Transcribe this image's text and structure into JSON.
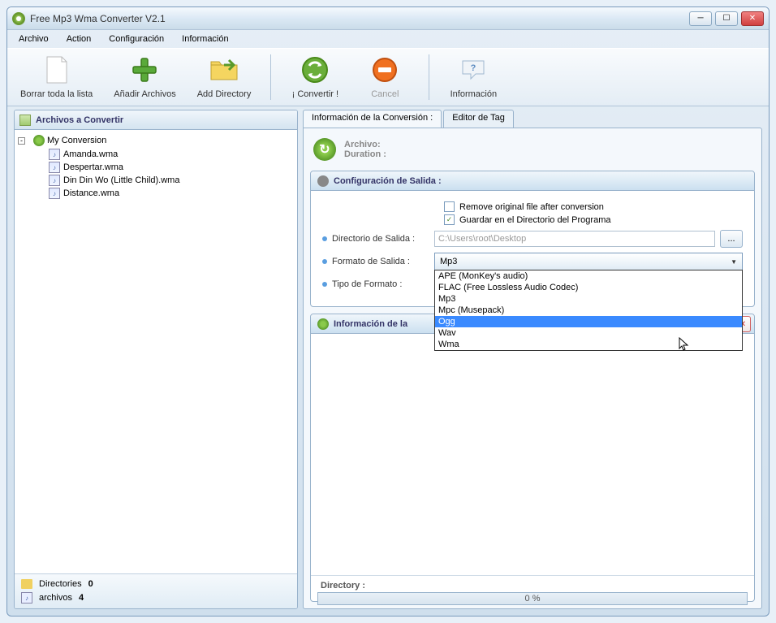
{
  "window": {
    "title": "Free Mp3 Wma Converter V2.1"
  },
  "menubar": {
    "items": [
      "Archivo",
      "Action",
      "Configuración",
      "Información"
    ]
  },
  "toolbar": {
    "clear": "Borrar toda la lista",
    "add_files": "Añadir Archivos",
    "add_dir": "Add Directory",
    "convert": "¡ Convertir !",
    "cancel": "Cancel",
    "info": "Información"
  },
  "left": {
    "header": "Archivos a Convertir",
    "root": "My Conversion",
    "files": [
      "Amanda.wma",
      "Despertar.wma",
      "Din Din Wo (Little Child).wma",
      "Distance.wma"
    ],
    "footer": {
      "dirs_label": "Directories",
      "dirs_count": "0",
      "files_label": "archivos",
      "files_count": "4"
    }
  },
  "tabs": {
    "info": "Información de la Conversión :",
    "tag": "Editor de Tag"
  },
  "conv_info": {
    "archivo": "Archivo:",
    "duration": "Duration :"
  },
  "output": {
    "header": "Configuración de Salida :",
    "remove_original": "Remove original file after conversion",
    "remove_checked": false,
    "save_prog_dir": "Guardar en el Directorio del Programa",
    "save_checked": true,
    "dir_label": "Directorio de Salida :",
    "dir_value": "C:\\Users\\root\\Desktop",
    "format_label": "Formato de Salida :",
    "format_value": "Mp3",
    "format_options": [
      "APE (MonKey's audio)",
      "FLAC (Free Lossless Audio Codec)",
      "Mp3",
      "Mpc (Musepack)",
      "Ogg",
      "Wav",
      "Wma"
    ],
    "format_highlighted": "Ogg",
    "type_label": "Tipo de Formato :"
  },
  "pista": {
    "header": "Información de la"
  },
  "footer": {
    "directory": "Directory :",
    "progress": "0 %"
  }
}
